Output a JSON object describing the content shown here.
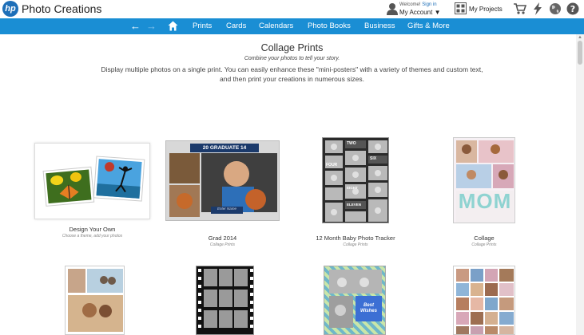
{
  "header": {
    "brand": "Photo Creations",
    "logo_text": "hp",
    "welcome": "Welcome!",
    "sign_in": "Sign in",
    "my_account": "My Account ▼",
    "my_projects": "My Projects",
    "icons": [
      "user-icon",
      "projects-icon",
      "cart-icon",
      "lightning-icon",
      "globe-icon",
      "help-icon"
    ]
  },
  "nav": {
    "items": [
      "Prints",
      "Cards",
      "Calendars",
      "Photo Books",
      "Business",
      "Gifts & More"
    ],
    "accent": "#1a8ed4"
  },
  "page": {
    "title": "Collage Prints",
    "subtitle": "Combine your photos to tell your story.",
    "description": "Display multiple photos on a single print. You can easily enhance these \"mini-posters\" with a variety of themes and custom text, and then print your creations in numerous sizes."
  },
  "products": [
    {
      "name": "Design Your Own",
      "sub": "Choose a theme, add your photos"
    },
    {
      "name": "Grad 2014",
      "sub": "Collage Prints",
      "banner": "20 GRADUATE 14",
      "caption": "Enter Name"
    },
    {
      "name": "12 Month Baby Photo Tracker",
      "sub": "Collage Prints",
      "labels": [
        "TWO",
        "FOUR",
        "SIX",
        "EIGHT",
        "ELEVEN"
      ]
    },
    {
      "name": "Collage",
      "sub": "Collage Prints",
      "word": "MOM"
    },
    {
      "name": "",
      "sub": ""
    },
    {
      "name": "",
      "sub": ""
    },
    {
      "name": "",
      "sub": "",
      "text": "Best Wishes"
    },
    {
      "name": "",
      "sub": ""
    }
  ]
}
